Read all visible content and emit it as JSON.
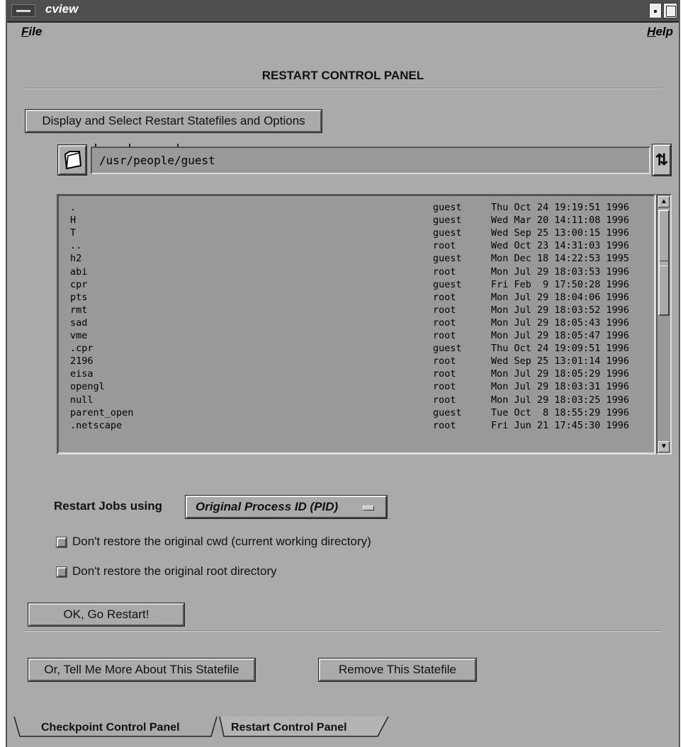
{
  "window": {
    "title": "cview"
  },
  "menubar": {
    "file": "File",
    "help": "Help"
  },
  "panel": {
    "title": "RESTART CONTROL PANEL"
  },
  "buttons": {
    "display_select": "Display and Select Restart Statefiles and Options",
    "ok_restart": "OK, Go Restart!",
    "tell_more": "Or, Tell Me More About This Statefile",
    "remove": "Remove This Statefile"
  },
  "path": {
    "value": "/usr/people/guest"
  },
  "files": [
    {
      "name": ".",
      "owner": "guest",
      "date": "Thu Oct 24 19:19:51 1996"
    },
    {
      "name": "H",
      "owner": "guest",
      "date": "Wed Mar 20 14:11:08 1996"
    },
    {
      "name": "T",
      "owner": "guest",
      "date": "Wed Sep 25 13:00:15 1996"
    },
    {
      "name": "..",
      "owner": "root",
      "date": "Wed Oct 23 14:31:03 1996"
    },
    {
      "name": "h2",
      "owner": "guest",
      "date": "Mon Dec 18 14:22:53 1995"
    },
    {
      "name": "abi",
      "owner": "root",
      "date": "Mon Jul 29 18:03:53 1996"
    },
    {
      "name": "cpr",
      "owner": "guest",
      "date": "Fri Feb  9 17:50:28 1996"
    },
    {
      "name": "pts",
      "owner": "root",
      "date": "Mon Jul 29 18:04:06 1996"
    },
    {
      "name": "rmt",
      "owner": "root",
      "date": "Mon Jul 29 18:03:52 1996"
    },
    {
      "name": "sad",
      "owner": "root",
      "date": "Mon Jul 29 18:05:43 1996"
    },
    {
      "name": "vme",
      "owner": "root",
      "date": "Mon Jul 29 18:05:47 1996"
    },
    {
      "name": ".cpr",
      "owner": "guest",
      "date": "Thu Oct 24 19:09:51 1996"
    },
    {
      "name": "2196",
      "owner": "root",
      "date": "Wed Sep 25 13:01:14 1996"
    },
    {
      "name": "eisa",
      "owner": "root",
      "date": "Mon Jul 29 18:05:29 1996"
    },
    {
      "name": "opengl",
      "owner": "root",
      "date": "Mon Jul 29 18:03:31 1996"
    },
    {
      "name": "null",
      "owner": "root",
      "date": "Mon Jul 29 18:03:25 1996"
    },
    {
      "name": "parent_open",
      "owner": "guest",
      "date": "Tue Oct  8 18:55:29 1996"
    },
    {
      "name": ".netscape",
      "owner": "root",
      "date": "Fri Jun 21 17:45:30 1996"
    }
  ],
  "restart": {
    "label": "Restart Jobs using",
    "option": "Original Process ID (PID)"
  },
  "options": {
    "cwd": "Don't restore the original cwd (current working directory)",
    "root": "Don't restore the original root directory"
  },
  "tabs": {
    "checkpoint": "Checkpoint Control Panel",
    "restart": "Restart Control Panel"
  },
  "icons": {
    "folder": "folder-icon",
    "spin": "spin-arrows-icon",
    "scroll_up": "arrow-up-icon",
    "scroll_down": "arrow-down-icon"
  }
}
